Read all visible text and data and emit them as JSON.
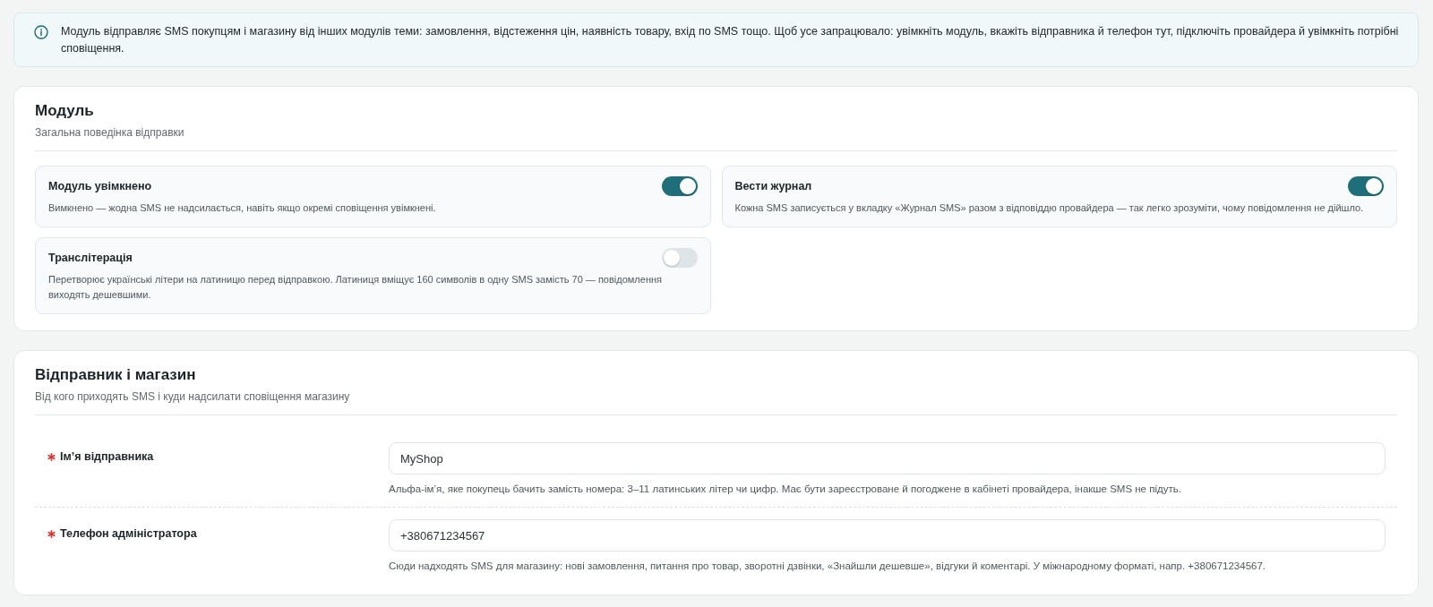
{
  "notice": {
    "text": "Модуль відправляє SMS покупцям і магазину від інших модулів теми: замовлення, відстеження цін, наявність товару, вхід по SMS тощо. Щоб усе запрацювало: увімкніть модуль, вкажіть відправника й телефон тут, підключіть провайдера й увімкніть потрібні сповіщення."
  },
  "sections": [
    {
      "kind": "toggles",
      "title": "Модуль",
      "subtitle": "Загальна поведінка відправки",
      "items": [
        {
          "label": "Модуль увімкнено",
          "description": "Вимкнено — жодна SMS не надсилається, навіть якщо окремі сповіщення увімкнені.",
          "on": true
        },
        {
          "label": "Вести журнал",
          "description": "Кожна SMS записується у вкладку «Журнал SMS» разом з відповіддю провайдера — так легко зрозуміти, чому повідомлення не дійшло.",
          "on": true
        },
        {
          "label": "Транслітерація",
          "description": "Перетворює українські літери на латиницю перед відправкою. Латиниця вміщує 160 символів в одну SMS замість 70 — повідомлення виходять дешевшими.",
          "on": false
        }
      ]
    },
    {
      "kind": "fields",
      "title": "Відправник і магазин",
      "subtitle": "Від кого приходять SMS і куди надсилати сповіщення магазину",
      "fields": [
        {
          "label": "Ім’я відправника",
          "required": true,
          "value": "MyShop",
          "hint": "Альфа-ім’я, яке покупець бачить замість номера: 3–11 латинських літер чи цифр. Має бути зареєстроване й погоджене в кабінеті провайдера, інакше SMS не підуть."
        },
        {
          "label": "Телефон адміністратора",
          "required": true,
          "value": "+380671234567",
          "hint": "Сюди надходять SMS для магазину: нові замовлення, питання про товар, зворотні дзвінки, «Знайшли дешевше», відгуки й коментарі. У міжнародному форматі, напр. +380671234567."
        }
      ]
    }
  ]
}
